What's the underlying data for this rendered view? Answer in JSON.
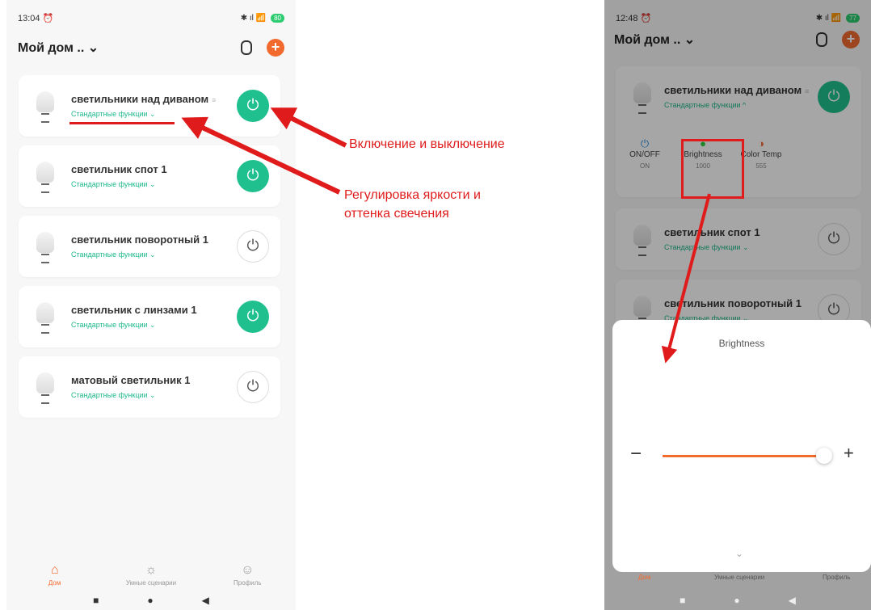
{
  "left": {
    "status": {
      "time": "13:04",
      "alarm": "⏰",
      "icons": "✱ ıl 📶",
      "battery": "80"
    },
    "home_title": "Мой дом ..",
    "header_chevron": "⌄",
    "devices": [
      {
        "name": "светильники над диваном",
        "func": "Стандартные функции ⌄",
        "power": "on"
      },
      {
        "name": "светильник спот 1",
        "func": "Стандартные функции ⌄",
        "power": "on"
      },
      {
        "name": "светильник поворотный 1",
        "func": "Стандартные функции ⌄",
        "power": "off"
      },
      {
        "name": "светильник с линзами 1",
        "func": "Стандартные функции ⌄",
        "power": "on"
      },
      {
        "name": "матовый светильник 1",
        "func": "Стандартные функции ⌄",
        "power": "off"
      }
    ],
    "power_glyph": "⏻",
    "tabs": [
      {
        "label": "Дом",
        "icon": "⌂",
        "active": true
      },
      {
        "label": "Умные сценарии",
        "icon": "☼",
        "active": false
      },
      {
        "label": "Профиль",
        "icon": "☺",
        "active": false
      }
    ],
    "nav": [
      "■",
      "●",
      "◀"
    ]
  },
  "annotations": {
    "power_text": "Включение и выключение",
    "brightness_line1": "Регулировка яркости и",
    "brightness_line2": "оттенка свечения"
  },
  "right": {
    "status": {
      "time": "12:48",
      "alarm": "⏰",
      "icons": "✱ ıl 📶",
      "battery": "77"
    },
    "home_title": "Мой дом ..",
    "header_chevron": "⌄",
    "devices": [
      {
        "name": "светильники над диваном",
        "func": "Стандартные функции ^",
        "power": "on"
      },
      {
        "name": "светильник спот 1",
        "func": "Стандартные функции ⌄",
        "power": "off"
      },
      {
        "name": "светильник поворотный 1",
        "func": "Стандартные функции ⌄",
        "power": "off"
      }
    ],
    "functions": [
      {
        "label": "ON/OFF",
        "value": "ON",
        "icon": "⏻"
      },
      {
        "label": "Brightness",
        "value": "1000",
        "icon": "●"
      },
      {
        "label": "Color Temp",
        "value": "555",
        "icon": "◑"
      }
    ],
    "sheet": {
      "title": "Brightness",
      "minus": "−",
      "plus": "+",
      "chevron": "⌄",
      "brightness_level": 1.0
    },
    "tabs": [
      "Дом",
      "Умные сценарии",
      "Профиль"
    ],
    "nav": [
      "■",
      "●",
      "◀"
    ]
  },
  "colors": {
    "accent": "#f26a2e",
    "power_on": "#1fc08e",
    "annotation": "#e01b1b"
  }
}
